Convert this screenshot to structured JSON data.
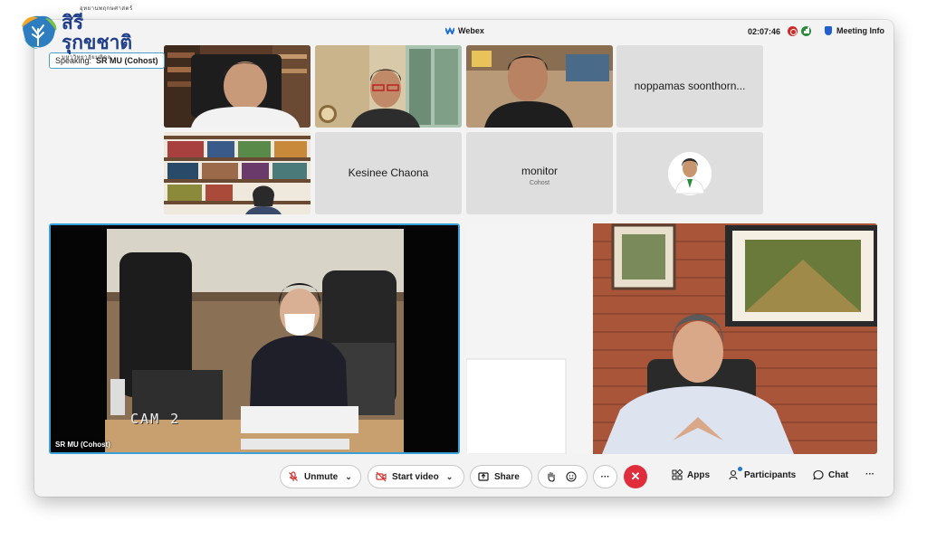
{
  "logo": {
    "title": "สิรีรุกขชาติ",
    "sub_top": "อุทยานพฤกษศาสตร์",
    "sub_bottom": "มหาวิทยาลัยมหิดล"
  },
  "titlebar": {
    "app_name": "Webex",
    "timer": "02:07:46",
    "meeting_info": "Meeting Info"
  },
  "speaking": {
    "label": "Speaking:",
    "name": "SR MU (Cohost)"
  },
  "tiles": {
    "t4": {
      "name": "noppamas soonthorn..."
    },
    "t6": {
      "name": "Kesinee Chaona"
    },
    "t7": {
      "name": "monitor",
      "role": "Cohost"
    }
  },
  "panes": {
    "left_label": "SR MU  (Cohost)",
    "cam_overlay": "CAM 2"
  },
  "controls": {
    "unmute": "Unmute",
    "start_video": "Start video",
    "share": "Share",
    "more": "···",
    "apps": "Apps",
    "participants": "Participants",
    "chat": "Chat",
    "overflow": "···"
  },
  "colors": {
    "accent": "#3aa0d8",
    "end_call": "#e02d3c",
    "mute_red": "#d0312d",
    "tile_bg": "#dedede"
  }
}
